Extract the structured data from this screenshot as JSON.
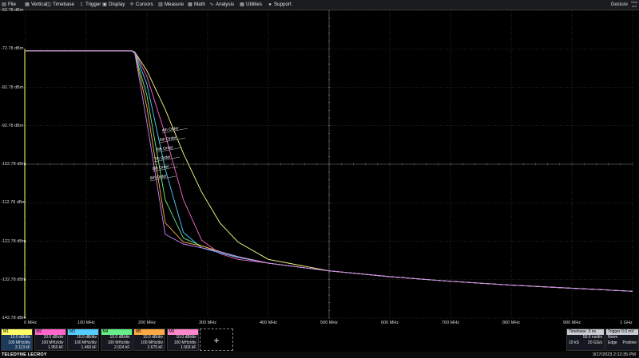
{
  "menu": {
    "items": [
      {
        "label": "File",
        "icon": "file-icon",
        "glyph": "▤"
      },
      {
        "label": "Vertical",
        "icon": "vertical-icon",
        "glyph": "▦"
      },
      {
        "label": "Timebase",
        "icon": "timebase-icon",
        "glyph": "◫"
      },
      {
        "label": "Trigger",
        "icon": "trigger-icon",
        "glyph": "⎍"
      },
      {
        "label": "Display",
        "icon": "display-icon",
        "glyph": "▣"
      },
      {
        "label": "Cursors",
        "icon": "cursors-icon",
        "glyph": "✛"
      },
      {
        "label": "Measure",
        "icon": "measure-icon",
        "glyph": "▥"
      },
      {
        "label": "Math",
        "icon": "math-icon",
        "glyph": "▦"
      },
      {
        "label": "Analysis",
        "icon": "analysis-icon",
        "glyph": "∿"
      },
      {
        "label": "Utilities",
        "icon": "utilities-icon",
        "glyph": "▦"
      },
      {
        "label": "Support",
        "icon": "support-icon",
        "glyph": "●"
      }
    ],
    "gesture_label": "Gesture",
    "corner_label": "Gest ure"
  },
  "chart_data": {
    "type": "line",
    "y_tick_labels": [
      "-62.78 dBm",
      "-72.78 dBm",
      "-82.78 dBm",
      "-92.78 dBm",
      "-102.78 dBm",
      "-112.78 dBm",
      "-122.78 dBm",
      "-132.78 dBm",
      "-142.78 dBm"
    ],
    "x_tick_labels": [
      "0 MHz",
      "100 MHz",
      "200 MHz",
      "300 MHz",
      "400 MHz",
      "500 MHz",
      "600 MHz",
      "700 MHz",
      "800 MHz",
      "900 MHz",
      "1 GHz"
    ],
    "ylim": [
      -142.78,
      -62.78
    ],
    "xlim": [
      0,
      1000
    ],
    "x_unit": "MHz",
    "y_unit": "dBm",
    "grid": true,
    "series": [
      {
        "color": "#ffff88",
        "x": [
          0,
          175,
          180,
          200,
          230,
          260,
          290,
          320,
          350,
          400,
          500,
          600,
          700,
          800,
          900,
          1000
        ],
        "values": [
          -73.3,
          -73.3,
          -73.6,
          -78.5,
          -88.5,
          -100,
          -110,
          -118,
          -123,
          -127.5,
          -130.5,
          -132,
          -133.2,
          -134.2,
          -135,
          -135.8
        ]
      },
      {
        "color": "#ff66cc",
        "x": [
          0,
          175,
          180,
          200,
          230,
          260,
          290,
          320,
          350,
          400,
          500,
          600,
          700,
          800,
          900,
          1000
        ],
        "values": [
          -73.3,
          -73.3,
          -73.6,
          -80,
          -95,
          -112,
          -122.5,
          -126,
          -127.5,
          -128.5,
          -130.5,
          -132,
          -133.2,
          -134.2,
          -135,
          -135.8
        ]
      },
      {
        "color": "#55ccff",
        "x": [
          0,
          175,
          180,
          200,
          230,
          260,
          290,
          320,
          350,
          400,
          500,
          600,
          700,
          800,
          900,
          1000
        ],
        "values": [
          -73.3,
          -73.3,
          -73.7,
          -82,
          -104,
          -120.5,
          -124.5,
          -125.8,
          -127,
          -128.5,
          -130.5,
          -132,
          -133.2,
          -134.2,
          -135,
          -135.8
        ]
      },
      {
        "color": "#66ee88",
        "x": [
          0,
          175,
          180,
          200,
          230,
          260,
          290,
          320,
          350,
          400,
          500,
          600,
          700,
          800,
          900,
          1000
        ],
        "values": [
          -73.3,
          -73.3,
          -73.8,
          -85,
          -112,
          -122,
          -124,
          -125.5,
          -126.8,
          -128.5,
          -130.5,
          -132,
          -133.2,
          -134.2,
          -135,
          -135.8
        ]
      },
      {
        "color": "#ffaa44",
        "x": [
          0,
          175,
          180,
          200,
          230,
          260,
          290,
          320,
          350,
          400,
          500,
          600,
          700,
          800,
          900,
          1000
        ],
        "values": [
          -73.3,
          -73.3,
          -73.9,
          -88,
          -118,
          -123,
          -124,
          -125.5,
          -126.8,
          -128.5,
          -130.5,
          -132,
          -133.2,
          -134.2,
          -135,
          -135.8
        ]
      },
      {
        "color": "#cc88ff",
        "x": [
          0,
          175,
          180,
          200,
          230,
          260,
          290,
          320,
          350,
          400,
          500,
          600,
          700,
          800,
          900,
          1000
        ],
        "values": [
          -73.3,
          -73.3,
          -74,
          -92,
          -121,
          -123.5,
          -124.5,
          -125.5,
          -126.8,
          -128.5,
          -130.5,
          -132,
          -133.2,
          -134.2,
          -135,
          -135.8
        ]
      }
    ],
    "annotations": [
      "4th Order",
      "5th Order",
      "6th Order",
      "7th Order",
      "8th Order",
      "9th Order"
    ]
  },
  "channels": [
    {
      "name": "M1",
      "color": "#ffff66",
      "line1": "10.0 dB/div",
      "line2": "100 MHz/div",
      "line3": "3.113 kF"
    },
    {
      "name": "M2",
      "color": "#ff66cc",
      "line1": "10.0 dB/div",
      "line2": "100 MHz/div",
      "line3": "1.950 kF"
    },
    {
      "name": "M3",
      "color": "#55ccff",
      "line1": "10.0 dB/div",
      "line2": "100 MHz/div",
      "line3": "1.469 kF"
    },
    {
      "name": "M4",
      "color": "#66ee88",
      "line1": "10.0 dB/div",
      "line2": "100 MHz/div",
      "line3": "2.024 kF"
    },
    {
      "name": "M5",
      "color": "#ffaa44",
      "line1": "10.0 dB/div",
      "line2": "100 MHz/div",
      "line3": "2.675 kF"
    },
    {
      "name": "M6",
      "color": "#ff88cc",
      "line1": "10.0 dB/div",
      "line2": "100 MHz/div",
      "line3": "1.503 kF"
    }
  ],
  "add_label": "+",
  "timebase": {
    "title": "Timebase",
    "offset": "0 ns",
    "rate": "50.0 ns/div",
    "samples": "10 kS",
    "sample_rate": "20 GS/s"
  },
  "trigger": {
    "title": "Trigger",
    "level": "0.0 mV",
    "mode": "Norm",
    "type": "Edge",
    "slope": "Positive"
  },
  "status": {
    "logo": "TELEDYNE LECROY",
    "datetime": "3/17/2023 2:12:35 PM"
  }
}
